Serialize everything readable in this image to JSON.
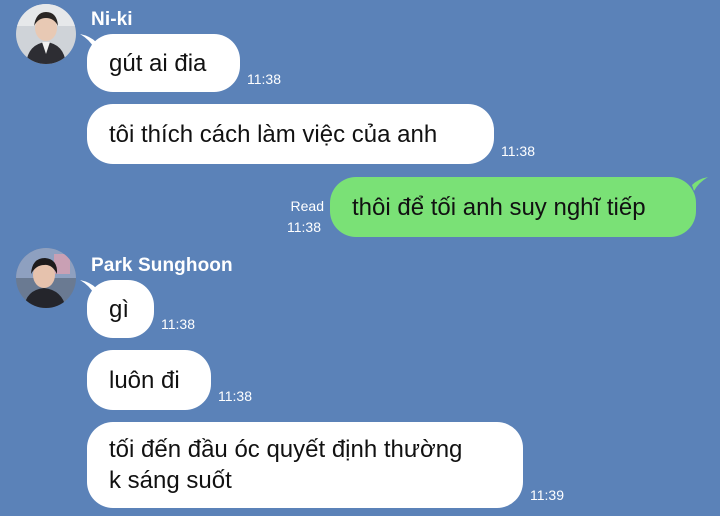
{
  "colors": {
    "background": "#5b82b8",
    "incoming_bubble": "#ffffff",
    "outgoing_bubble": "#7ae176",
    "meta_text": "#ffffff"
  },
  "senders": [
    {
      "name": "Ni-ki",
      "avatar_icon": "profile-avatar"
    },
    {
      "name": "Park Sunghoon",
      "avatar_icon": "profile-avatar"
    }
  ],
  "messages": [
    {
      "text": "gút ai đia",
      "time": "11:38"
    },
    {
      "text": "tôi thích cách làm việc của anh",
      "time": "11:38"
    },
    {
      "text": "thôi để tối anh suy nghĩ tiếp",
      "time": "11:38",
      "status": "Read"
    },
    {
      "text": "gì",
      "time": "11:38"
    },
    {
      "text": "luôn đi",
      "time": "11:38"
    },
    {
      "lines": [
        "tối đến đầu óc quyết định thường",
        "k sáng suốt"
      ],
      "time": "11:39"
    }
  ]
}
